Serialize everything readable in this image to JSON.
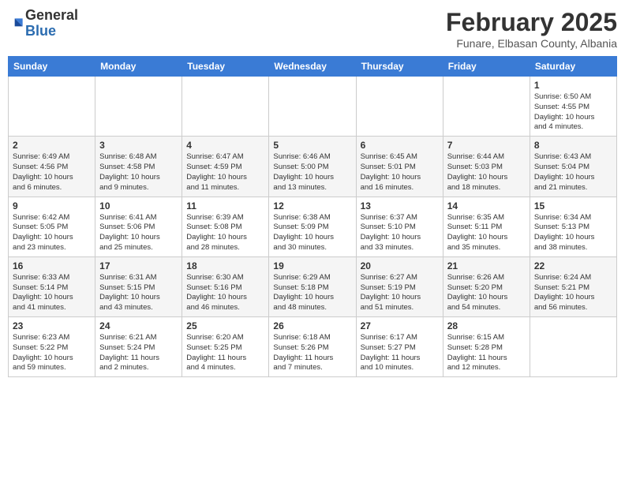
{
  "logo": {
    "general": "General",
    "blue": "Blue"
  },
  "title": "February 2025",
  "location": "Funare, Elbasan County, Albania",
  "days_of_week": [
    "Sunday",
    "Monday",
    "Tuesday",
    "Wednesday",
    "Thursday",
    "Friday",
    "Saturday"
  ],
  "weeks": [
    [
      {
        "day": "",
        "info": ""
      },
      {
        "day": "",
        "info": ""
      },
      {
        "day": "",
        "info": ""
      },
      {
        "day": "",
        "info": ""
      },
      {
        "day": "",
        "info": ""
      },
      {
        "day": "",
        "info": ""
      },
      {
        "day": "1",
        "info": "Sunrise: 6:50 AM\nSunset: 4:55 PM\nDaylight: 10 hours\nand 4 minutes."
      }
    ],
    [
      {
        "day": "2",
        "info": "Sunrise: 6:49 AM\nSunset: 4:56 PM\nDaylight: 10 hours\nand 6 minutes."
      },
      {
        "day": "3",
        "info": "Sunrise: 6:48 AM\nSunset: 4:58 PM\nDaylight: 10 hours\nand 9 minutes."
      },
      {
        "day": "4",
        "info": "Sunrise: 6:47 AM\nSunset: 4:59 PM\nDaylight: 10 hours\nand 11 minutes."
      },
      {
        "day": "5",
        "info": "Sunrise: 6:46 AM\nSunset: 5:00 PM\nDaylight: 10 hours\nand 13 minutes."
      },
      {
        "day": "6",
        "info": "Sunrise: 6:45 AM\nSunset: 5:01 PM\nDaylight: 10 hours\nand 16 minutes."
      },
      {
        "day": "7",
        "info": "Sunrise: 6:44 AM\nSunset: 5:03 PM\nDaylight: 10 hours\nand 18 minutes."
      },
      {
        "day": "8",
        "info": "Sunrise: 6:43 AM\nSunset: 5:04 PM\nDaylight: 10 hours\nand 21 minutes."
      }
    ],
    [
      {
        "day": "9",
        "info": "Sunrise: 6:42 AM\nSunset: 5:05 PM\nDaylight: 10 hours\nand 23 minutes."
      },
      {
        "day": "10",
        "info": "Sunrise: 6:41 AM\nSunset: 5:06 PM\nDaylight: 10 hours\nand 25 minutes."
      },
      {
        "day": "11",
        "info": "Sunrise: 6:39 AM\nSunset: 5:08 PM\nDaylight: 10 hours\nand 28 minutes."
      },
      {
        "day": "12",
        "info": "Sunrise: 6:38 AM\nSunset: 5:09 PM\nDaylight: 10 hours\nand 30 minutes."
      },
      {
        "day": "13",
        "info": "Sunrise: 6:37 AM\nSunset: 5:10 PM\nDaylight: 10 hours\nand 33 minutes."
      },
      {
        "day": "14",
        "info": "Sunrise: 6:35 AM\nSunset: 5:11 PM\nDaylight: 10 hours\nand 35 minutes."
      },
      {
        "day": "15",
        "info": "Sunrise: 6:34 AM\nSunset: 5:13 PM\nDaylight: 10 hours\nand 38 minutes."
      }
    ],
    [
      {
        "day": "16",
        "info": "Sunrise: 6:33 AM\nSunset: 5:14 PM\nDaylight: 10 hours\nand 41 minutes."
      },
      {
        "day": "17",
        "info": "Sunrise: 6:31 AM\nSunset: 5:15 PM\nDaylight: 10 hours\nand 43 minutes."
      },
      {
        "day": "18",
        "info": "Sunrise: 6:30 AM\nSunset: 5:16 PM\nDaylight: 10 hours\nand 46 minutes."
      },
      {
        "day": "19",
        "info": "Sunrise: 6:29 AM\nSunset: 5:18 PM\nDaylight: 10 hours\nand 48 minutes."
      },
      {
        "day": "20",
        "info": "Sunrise: 6:27 AM\nSunset: 5:19 PM\nDaylight: 10 hours\nand 51 minutes."
      },
      {
        "day": "21",
        "info": "Sunrise: 6:26 AM\nSunset: 5:20 PM\nDaylight: 10 hours\nand 54 minutes."
      },
      {
        "day": "22",
        "info": "Sunrise: 6:24 AM\nSunset: 5:21 PM\nDaylight: 10 hours\nand 56 minutes."
      }
    ],
    [
      {
        "day": "23",
        "info": "Sunrise: 6:23 AM\nSunset: 5:22 PM\nDaylight: 10 hours\nand 59 minutes."
      },
      {
        "day": "24",
        "info": "Sunrise: 6:21 AM\nSunset: 5:24 PM\nDaylight: 11 hours\nand 2 minutes."
      },
      {
        "day": "25",
        "info": "Sunrise: 6:20 AM\nSunset: 5:25 PM\nDaylight: 11 hours\nand 4 minutes."
      },
      {
        "day": "26",
        "info": "Sunrise: 6:18 AM\nSunset: 5:26 PM\nDaylight: 11 hours\nand 7 minutes."
      },
      {
        "day": "27",
        "info": "Sunrise: 6:17 AM\nSunset: 5:27 PM\nDaylight: 11 hours\nand 10 minutes."
      },
      {
        "day": "28",
        "info": "Sunrise: 6:15 AM\nSunset: 5:28 PM\nDaylight: 11 hours\nand 12 minutes."
      },
      {
        "day": "",
        "info": ""
      }
    ]
  ]
}
